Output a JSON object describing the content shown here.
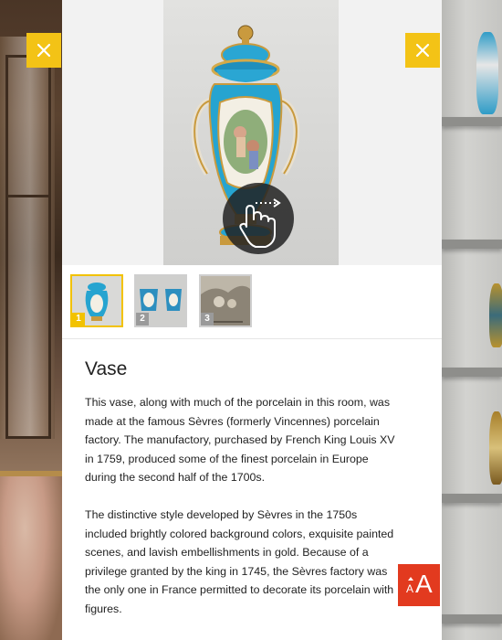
{
  "gallery": {
    "thumbnails": [
      {
        "number": "1",
        "subject": "vase front"
      },
      {
        "number": "2",
        "subject": "vase side views"
      },
      {
        "number": "3",
        "subject": "engraving"
      }
    ],
    "selected_index": 1
  },
  "article": {
    "title": "Vase",
    "paragraphs": [
      "This vase, along with much of the porcelain in this room, was made at the famous Sèvres (formerly Vincennes) porcelain factory. The manufactory, purchased by French King Louis XV in 1759, produced some of the finest porcelain in Europe during the second half of the 1700s.",
      "The distinctive style developed by Sèvres in the 1750s included brightly colored background colors, exquisite painted scenes, and lavish embellishments in gold. Because of a privilege granted by the king in 1745, the Sèvres factory was the only one in France permitted to decorate its porcelain with figures."
    ]
  },
  "controls": {
    "close_icon": "close-icon",
    "swipe_icon": "swipe-hand-icon",
    "font_size_icon": "font-size-icon",
    "font_size_glyph_small": "A",
    "font_size_glyph_large": "A"
  },
  "colors": {
    "accent_yellow": "#f3c316",
    "font_button_red": "#e23a1f",
    "vase_blue": "#26a4d0"
  }
}
